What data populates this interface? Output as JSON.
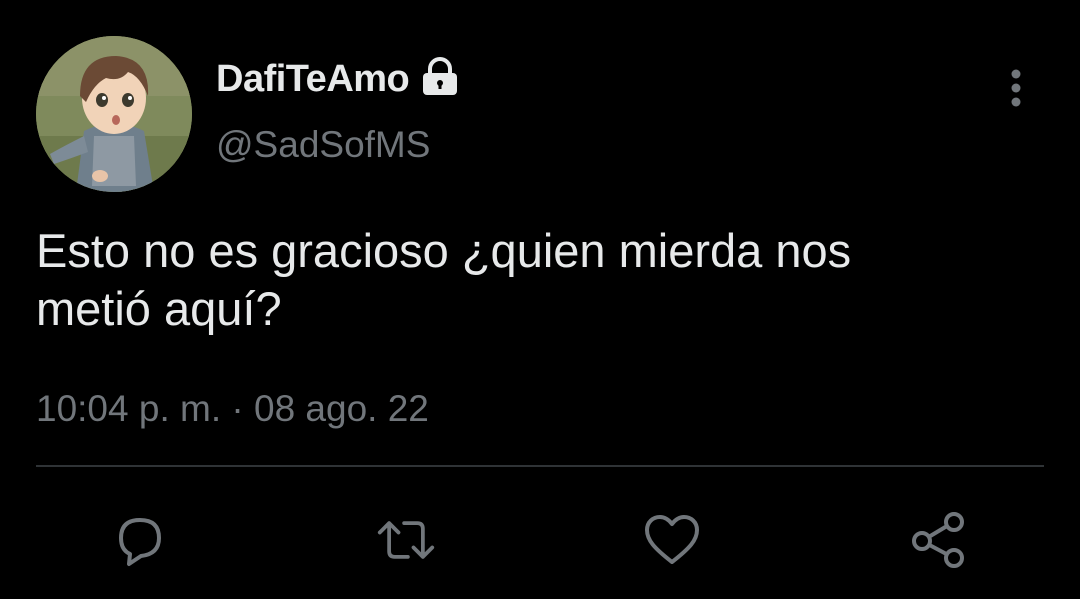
{
  "tweet": {
    "display_name": "DafiTeAmo",
    "handle": "@SadSofMS",
    "text_line1": "Esto no es gracioso ¿quien mierda nos",
    "text_line2": "metió aquí?",
    "time": "10:04 p. m.",
    "separator": "·",
    "date": "08 ago. 22"
  },
  "icons": {
    "account": "lock-icon",
    "menu": "more-vertical-icon",
    "reply": "reply-icon",
    "retweet": "retweet-icon",
    "like": "like-icon",
    "share": "share-icon"
  },
  "colors": {
    "background": "#000000",
    "primary_text": "#e7e9ea",
    "secondary_text": "#71767b",
    "divider": "#2f3336"
  }
}
